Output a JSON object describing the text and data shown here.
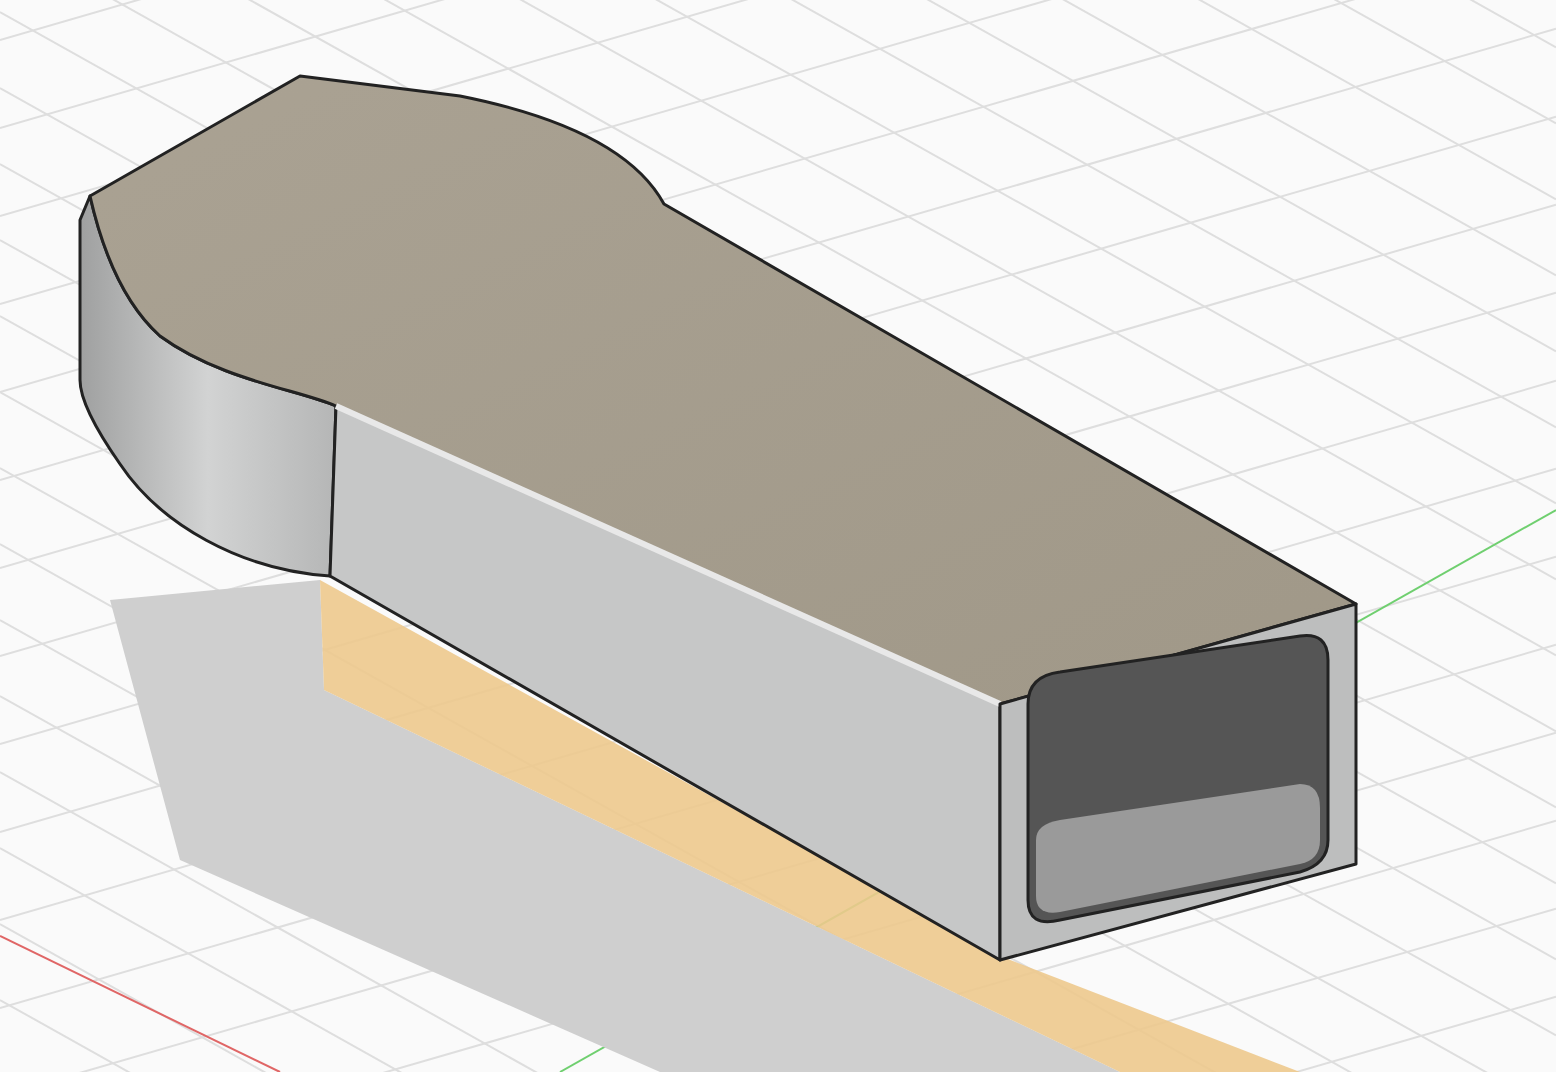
{
  "viewport": {
    "grid": true,
    "axes": true,
    "selection_projection": true
  }
}
